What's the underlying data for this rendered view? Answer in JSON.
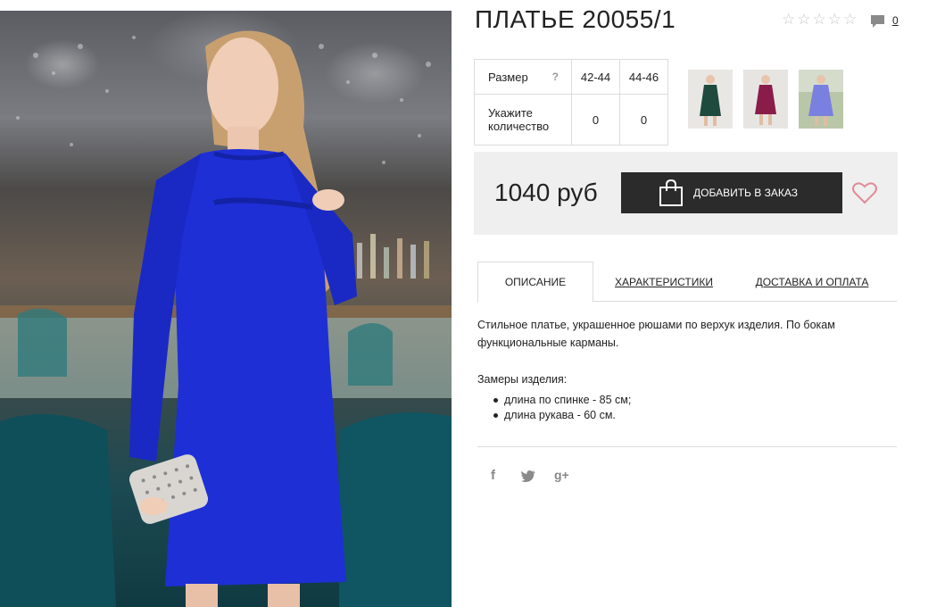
{
  "product": {
    "title": "ПЛАТЬЕ 20055/1",
    "rating": 0,
    "max_rating": 5,
    "comment_count": "0",
    "main_image_alt": "Model in royal blue long-sleeve dress with ruffle trim holding a studded clutch"
  },
  "size_table": {
    "size_label": "Размер",
    "hint": "?",
    "sizes": [
      "42-44",
      "44-46"
    ],
    "quantity_label_line1": "Укажите",
    "quantity_label_line2": "количество",
    "quantities": [
      "0",
      "0"
    ]
  },
  "thumbnails": [
    {
      "color": "#1f4a3e",
      "name": "green"
    },
    {
      "color": "#8a1c4a",
      "name": "burgundy"
    },
    {
      "color": "#7a80e0",
      "name": "lavender"
    }
  ],
  "purchase": {
    "price": "1040 руб",
    "add_button": "ДОБАВИТЬ В ЗАКАЗ"
  },
  "tabs": [
    {
      "label": "ОПИСАНИЕ",
      "active": true
    },
    {
      "label": "ХАРАКТЕРИСТИКИ",
      "active": false
    },
    {
      "label": "ДОСТАВКА И ОПЛАТА",
      "active": false
    }
  ],
  "description": {
    "text": "Стильное платье, украшенное рюшами по верхук изделия. По бокам функциональные карманы.",
    "measures_title": "Замеры изделия:",
    "measures": [
      "длина по спинке - 85 см;",
      "длина рукава - 60 см."
    ]
  },
  "social": {
    "facebook": "f",
    "twitter": "t",
    "googleplus": "g+"
  },
  "colors": {
    "dress": "#1e2fd6",
    "button_bg": "#2b2b2b",
    "price_box_bg": "#efefef",
    "heart": "#e08a98",
    "star_empty": "#c8c8c8"
  }
}
